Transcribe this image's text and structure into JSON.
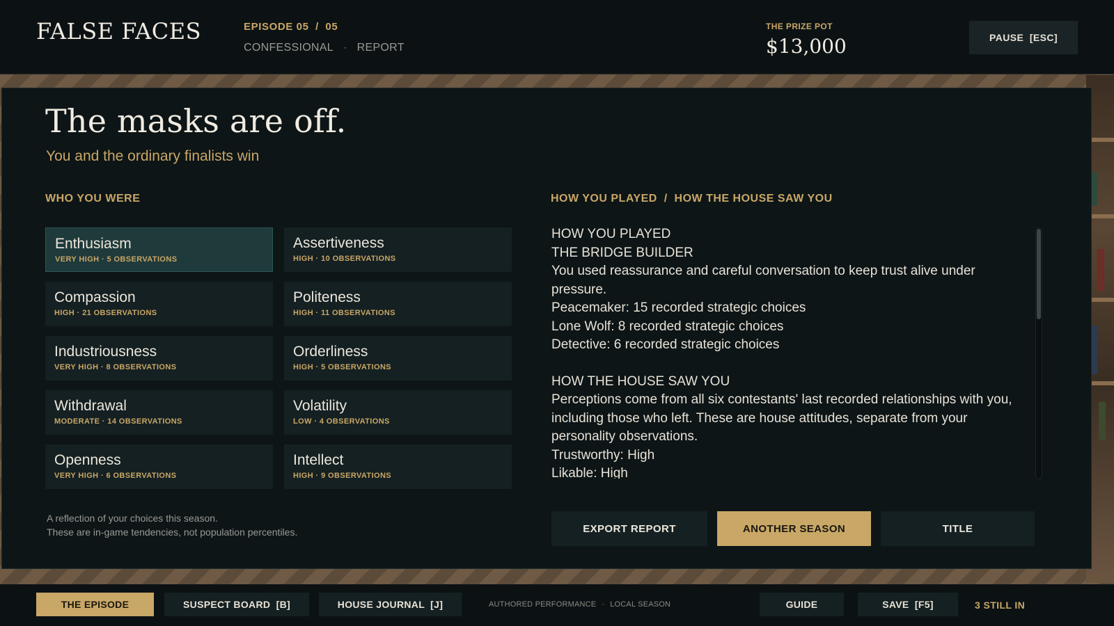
{
  "header": {
    "brand": "FALSE FACES",
    "episode": "EPISODE 05  /  05",
    "crumb_current": "CONFESSIONAL",
    "crumb_separator": "·",
    "crumb_next": "REPORT",
    "prize_label": "THE PRIZE POT",
    "prize_value": "$13,000",
    "pause_label": "PAUSE  [ESC]"
  },
  "panel": {
    "headline": "The masks are off.",
    "subline": "You and the ordinary finalists win",
    "who_label": "WHO YOU WERE",
    "report_label": "HOW YOU PLAYED  /  HOW THE HOUSE SAW YOU",
    "traits": [
      {
        "name": "Enthusiasm",
        "meta": "VERY HIGH · 5 OBSERVATIONS",
        "active": true
      },
      {
        "name": "Assertiveness",
        "meta": "HIGH · 10 OBSERVATIONS",
        "active": false
      },
      {
        "name": "Compassion",
        "meta": "HIGH · 21 OBSERVATIONS",
        "active": false
      },
      {
        "name": "Politeness",
        "meta": "HIGH · 11 OBSERVATIONS",
        "active": false
      },
      {
        "name": "Industriousness",
        "meta": "VERY HIGH · 8 OBSERVATIONS",
        "active": false
      },
      {
        "name": "Orderliness",
        "meta": "HIGH · 5 OBSERVATIONS",
        "active": false
      },
      {
        "name": "Withdrawal",
        "meta": "MODERATE · 14 OBSERVATIONS",
        "active": false
      },
      {
        "name": "Volatility",
        "meta": "LOW · 4 OBSERVATIONS",
        "active": false
      },
      {
        "name": "Openness",
        "meta": "VERY HIGH · 6 OBSERVATIONS",
        "active": false
      },
      {
        "name": "Intellect",
        "meta": "HIGH · 9 OBSERVATIONS",
        "active": false
      }
    ],
    "footnote_1": "A reflection of your choices this season.",
    "footnote_2": "These are in-game tendencies, not population percentiles.",
    "report": {
      "played_heading": "HOW YOU PLAYED",
      "archetype": "THE BRIDGE BUILDER",
      "archetype_desc": "You used reassurance and careful conversation to keep trust alive under pressure.",
      "styles": [
        "Peacemaker: 15 recorded strategic choices",
        "Lone Wolf: 8 recorded strategic choices",
        "Detective: 6 recorded strategic choices"
      ],
      "house_heading": "HOW THE HOUSE SAW YOU",
      "house_desc": "Perceptions come from all six contestants' last recorded relationships with you, including those who left. These are house attitudes, separate from your personality observations.",
      "perceptions": [
        "Trustworthy: High",
        "Likable: High"
      ]
    },
    "scroll_position": 0.0,
    "actions": {
      "export": "EXPORT REPORT",
      "another": "ANOTHER SEASON",
      "title": "TITLE"
    }
  },
  "footer": {
    "episode_tab": "THE EPISODE",
    "suspect_tab": "SUSPECT BOARD  [B]",
    "journal_tab": "HOUSE JOURNAL  [J]",
    "meta_1": "AUTHORED PERFORMANCE",
    "meta_sep": "·",
    "meta_2": "LOCAL SEASON",
    "guide": "GUIDE",
    "save": "SAVE  [F5]",
    "status": "3 STILL IN"
  },
  "colors": {
    "accent_gold": "#c9a766",
    "panel_bg": "#0d1517",
    "tile_bg": "#152022",
    "tile_active": "#1f3a3b"
  }
}
